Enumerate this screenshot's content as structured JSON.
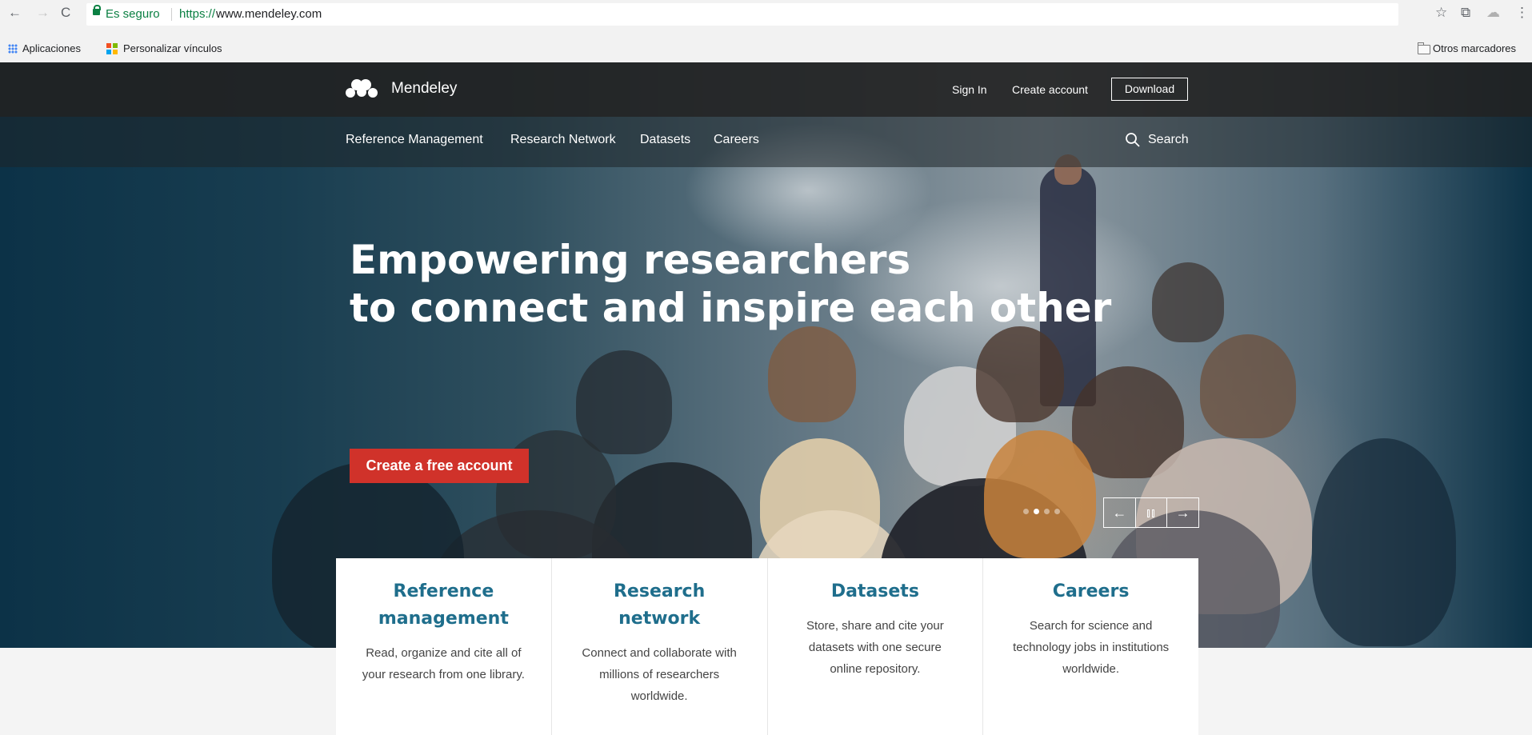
{
  "browser": {
    "nav": {
      "back": "←",
      "forward": "→",
      "reload": "C"
    },
    "secure_label": "Es seguro",
    "url_scheme": "https://",
    "url_host": "www.mendeley.com",
    "bookmarks": [
      {
        "label": "Aplicaciones",
        "icon": "apps-grid-icon"
      },
      {
        "label": "Personalizar vínculos",
        "icon": "microsoft-logo-icon"
      }
    ],
    "other_bookmarks": "Otros marcadores",
    "right_icons": {
      "star": "☆",
      "cast": "⧉",
      "extension": "☁",
      "menu": "⋮"
    }
  },
  "site": {
    "logo_text": "Mendeley",
    "top_links": {
      "sign_in": "Sign In",
      "create_account": "Create account"
    },
    "download_label": "Download",
    "nav": [
      "Reference Management",
      "Research Network",
      "Datasets",
      "Careers"
    ],
    "search_label": "Search"
  },
  "hero": {
    "headline_line1": "Empowering researchers",
    "headline_line2": "to connect and inspire each other",
    "cta_label": "Create a free account",
    "carousel": {
      "slide_count": 4,
      "active_slide": 2,
      "prev": "←",
      "next": "→"
    }
  },
  "cards": [
    {
      "title": "Reference management",
      "text": "Read, organize and cite all of your research from one library."
    },
    {
      "title": "Research network",
      "text": "Connect and collaborate with millions of researchers worldwide."
    },
    {
      "title": "Datasets",
      "text": "Store, share and cite your datasets with one secure online repository."
    },
    {
      "title": "Careers",
      "text": "Search for science and technology jobs in institutions worldwide."
    }
  ],
  "colors": {
    "cta_red": "#d0322a",
    "card_title_blue": "#1f6e8c",
    "secure_green": "#0b8043",
    "header_dark": "#212121"
  }
}
